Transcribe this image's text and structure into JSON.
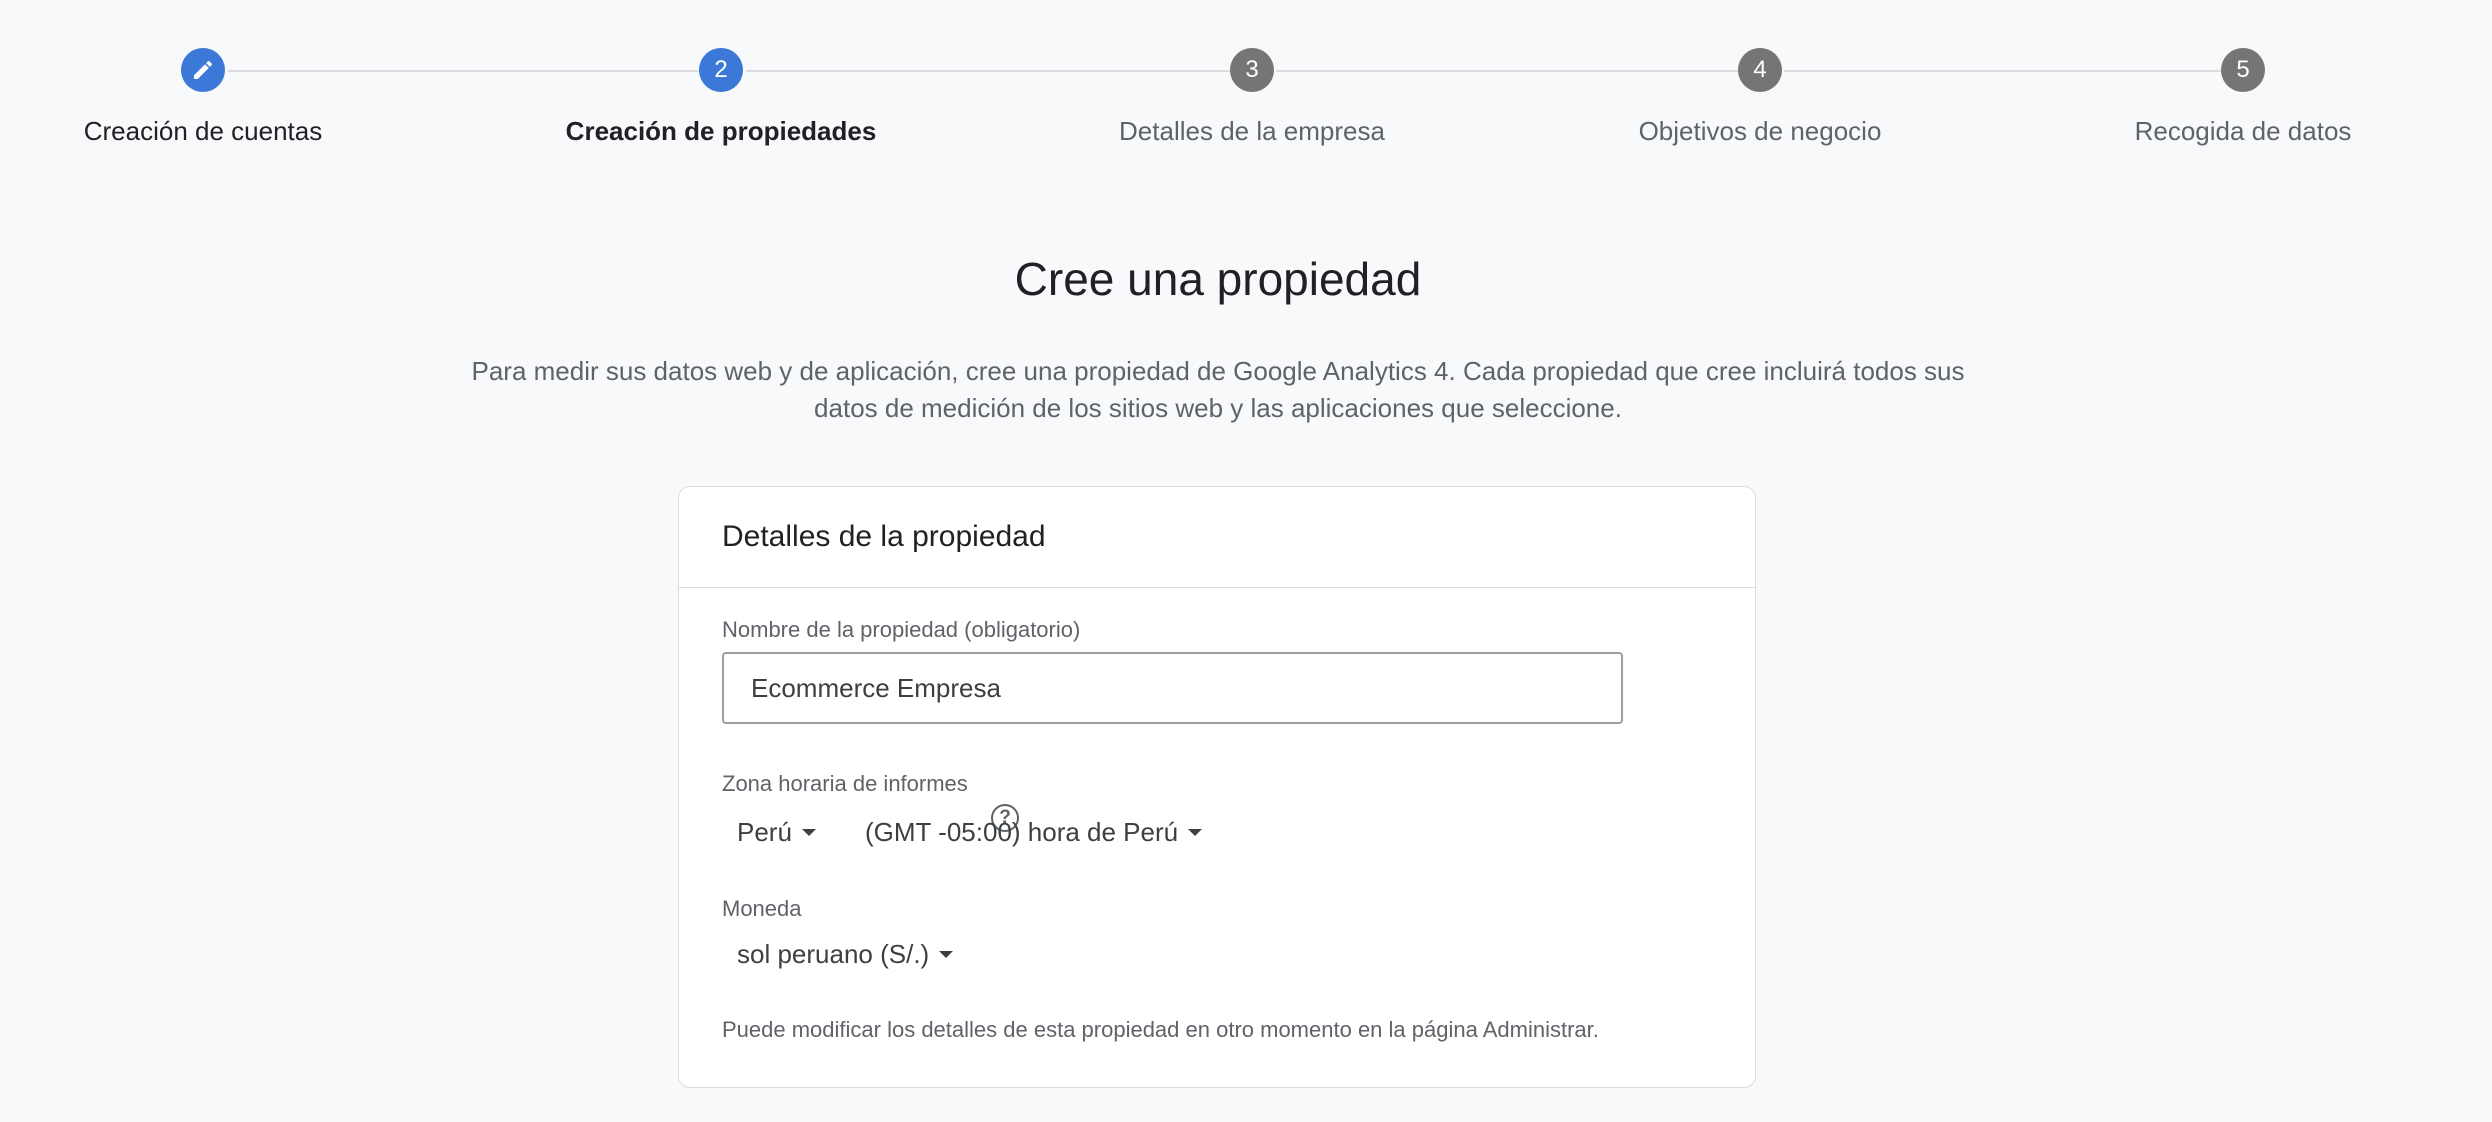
{
  "steps": [
    {
      "label": "Creación de cuentas",
      "icon": "pencil-icon",
      "state": "done"
    },
    {
      "label": "Creación de propiedades",
      "number": "2",
      "state": "current"
    },
    {
      "label": "Detalles de la empresa",
      "number": "3",
      "state": "pending"
    },
    {
      "label": "Objetivos de negocio",
      "number": "4",
      "state": "pending"
    },
    {
      "label": "Recogida de datos",
      "number": "5",
      "state": "pending"
    }
  ],
  "page": {
    "title": "Cree una propiedad",
    "description": "Para medir sus datos web y de aplicación, cree una propiedad de Google Analytics 4. Cada propiedad que cree incluirá todos sus datos de medición de los sitios web y las aplicaciones que seleccione."
  },
  "card": {
    "title": "Detalles de la propiedad",
    "property_name": {
      "label": "Nombre de la propiedad (obligatorio)",
      "value": "Ecommerce Empresa"
    },
    "timezone": {
      "label": "Zona horaria de informes",
      "country": "Perú",
      "zone": "(GMT -05:00) hora de Perú"
    },
    "currency": {
      "label": "Moneda",
      "value": "sol peruano (S/.)"
    },
    "footnote": "Puede modificar los detalles de esta propiedad en otro momento en la página Administrar."
  },
  "colors": {
    "accent": "#3c78d8",
    "pending_step": "#757575",
    "background": "#f8f9fa"
  }
}
